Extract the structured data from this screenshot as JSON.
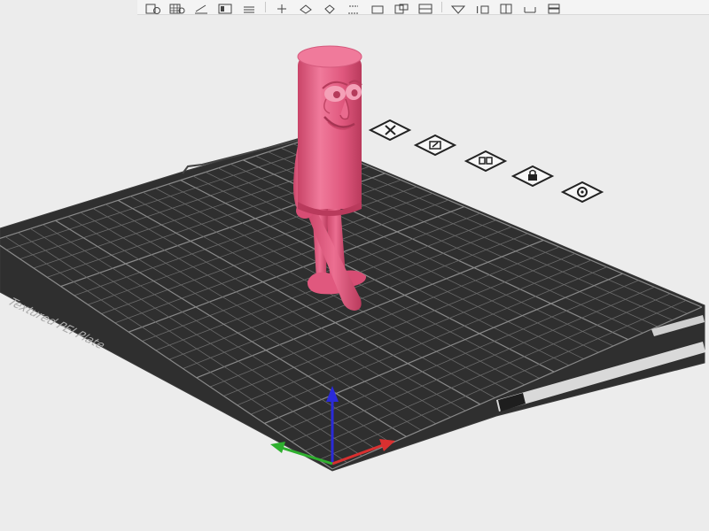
{
  "plate": {
    "label": "Textured PEI Plate"
  },
  "model": {
    "color": "#e0587e",
    "shade": "#c94468",
    "highlight": "#f07a9b"
  },
  "axes": {
    "x_color": "#d93030",
    "y_color": "#2fb02f",
    "z_color": "#2a2ad8"
  },
  "plate_buttons": [
    {
      "name": "delete-plate-icon"
    },
    {
      "name": "auto-orient-icon"
    },
    {
      "name": "arrange-icon"
    },
    {
      "name": "lock-plate-icon"
    },
    {
      "name": "plate-settings-icon"
    }
  ],
  "toolbar": {
    "icons": [
      "add-object-icon",
      "add-plate-icon",
      "orient-icon",
      "arrange-icon",
      "split-icon",
      "move-icon",
      "rotate-icon",
      "scale-icon",
      "cut-icon",
      "support-paint-icon",
      "seam-paint-icon",
      "color-paint-icon",
      "text-icon",
      "assembly-icon",
      "measure-icon",
      "view-icon",
      "layers-icon"
    ]
  }
}
